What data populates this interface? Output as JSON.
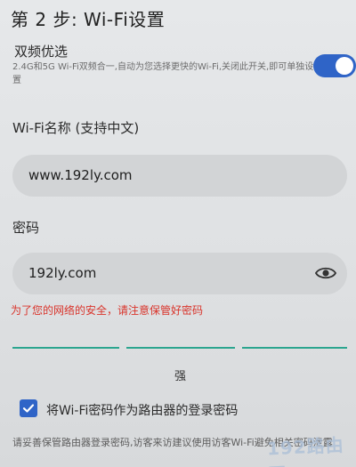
{
  "header": {
    "title": "第 2 步: Wi-Fi设置"
  },
  "dual_band": {
    "label": "双频优选",
    "description": "2.4G和5G Wi-Fi双频合一,自动为您选择更快的Wi-Fi,关闭此开关,即可单独设置",
    "enabled": true
  },
  "ssid": {
    "label": "Wi-Fi名称 (支持中文)",
    "value": "www.192ly.com"
  },
  "password": {
    "label": "密码",
    "value": "192ly.com",
    "show_icon": "eye-icon"
  },
  "warning": {
    "text": "为了您的网络的安全，请注意保管好密码"
  },
  "strength": {
    "label": "强",
    "level": 3,
    "max_level": 3,
    "color": "#2ba58f"
  },
  "login_password_option": {
    "checked": true,
    "label": "将Wi-Fi密码作为路由器的登录密码"
  },
  "footer": {
    "note": "请妥善保管路由器登录密码,访客来访建议使用访客Wi-Fi避免相关密码泄露"
  },
  "watermark": {
    "text": "192路由网"
  },
  "colors": {
    "accent": "#2f64c7",
    "warning": "#d9342b",
    "strength": "#2ba58f"
  }
}
